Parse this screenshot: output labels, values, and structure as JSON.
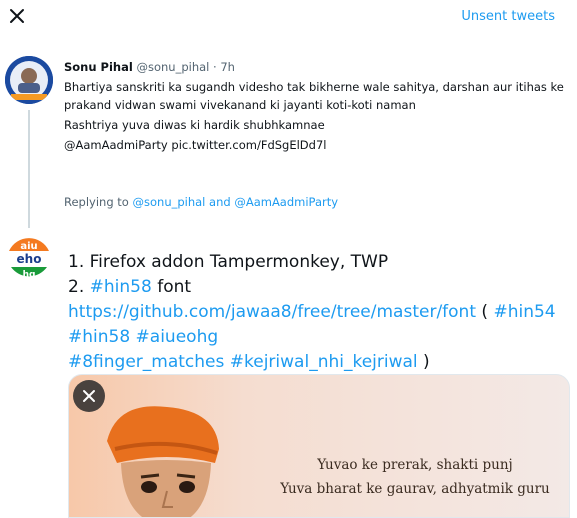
{
  "header": {
    "unsent_label": "Unsent tweets"
  },
  "tweet1": {
    "name": "Sonu Pihal",
    "handle": "@sonu_pihal",
    "time": "7h",
    "body_line1": "Bhartiya sanskriti ka sugandh videsho tak bikherne wale sahitya, darshan aur itihas ke prakand vidwan swami vivekanand ki jayanti koti-koti naman",
    "body_line2": "Rashtriya yuva diwas ki hardik shubhkamnae",
    "body_line3": "@AamAadmiParty pic.twitter.com/FdSgElDd7l",
    "replying_prefix": "Replying to",
    "replying_users": "@sonu_pihal and @AamAadmiParty"
  },
  "tweet2": {
    "line1": "1. Firefox addon Tampermonkey, TWP",
    "line2_prefix": "2.",
    "line2_tag": "#hin58",
    "line2_word": "font",
    "line2_url": "https://github.com/jawaa8/free/tree/master/font",
    "line3_tags": "#hin54 #hin58 #aiueohg",
    "line4_tags": "#8finger_matches #kejriwal_nhi_kejriwal",
    "line4_suffix": ")",
    "open_paren": "("
  },
  "media": {
    "quote_line1": "Yuvao ke prerak, shakti punj",
    "quote_line2": "Yuva bharat ke gaurav, adhyatmik guru"
  },
  "avatar2_text": {
    "top": "aiu",
    "middle": "eho",
    "bottom": "hg"
  }
}
